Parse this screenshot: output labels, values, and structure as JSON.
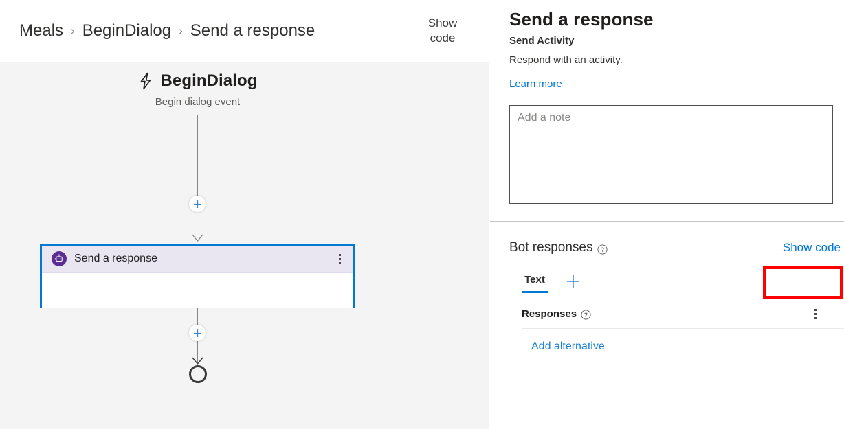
{
  "breadcrumb": {
    "items": [
      {
        "label": "Meals"
      },
      {
        "label": "BeginDialog"
      },
      {
        "label": "Send a response"
      }
    ],
    "separator": "›",
    "show_code_label": "Show\ncode"
  },
  "canvas": {
    "trigger": {
      "icon": "lightning-bolt-icon",
      "title": "BeginDialog",
      "subtitle": "Begin dialog event"
    },
    "add_button_label": "+",
    "node": {
      "icon": "bot-icon",
      "label": "Send a response",
      "menu_label": "⋮",
      "border_color": "#0078d4",
      "header_color": "#e9e5f1"
    },
    "end_node_label": "end"
  },
  "panel": {
    "title": "Send a response",
    "subtitle": "Send Activity",
    "description": "Respond with an activity.",
    "learn_more_label": "Learn more",
    "note": {
      "value": "",
      "placeholder": "Add a note"
    },
    "bot_responses": {
      "label": "Bot responses",
      "help_icon": "help-circle-icon",
      "show_code_label": "Show code",
      "highlight_color": "#ff0000"
    },
    "tabs": [
      {
        "label": "Text",
        "selected": true
      }
    ],
    "add_tab_label": "+",
    "responses": {
      "label": "Responses",
      "help_icon": "help-circle-icon",
      "menu_label": "⋮",
      "add_alternative_label": "Add alternative"
    }
  },
  "colors": {
    "accent": "#0078d4",
    "link": "#0078d4",
    "bot_purple": "#5c2d91",
    "canvas_bg": "#f4f4f4",
    "highlight": "#ff0000"
  }
}
